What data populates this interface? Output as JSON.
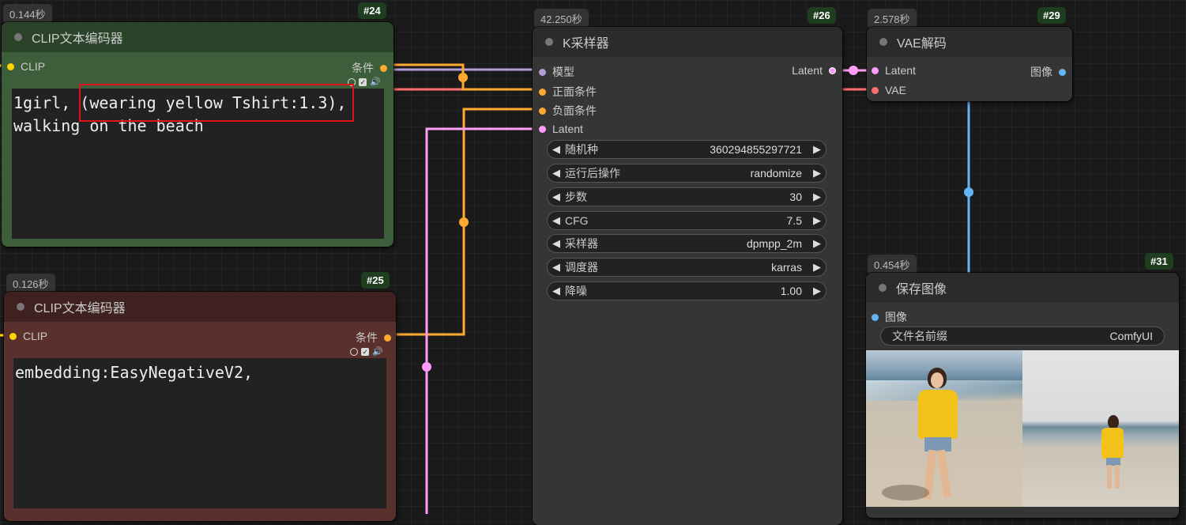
{
  "node24": {
    "time": "0.144秒",
    "id": "#24",
    "title": "CLIP文本编码器",
    "input_label": "CLIP",
    "output_label": "条件",
    "text": "1girl, (wearing yellow Tshirt:1.3),\nwalking on the beach",
    "color": "#2f4a2f"
  },
  "node25": {
    "time": "0.126秒",
    "id": "#25",
    "title": "CLIP文本编码器",
    "input_label": "CLIP",
    "output_label": "条件",
    "text": "embedding:EasyNegativeV2,",
    "color": "#4e2a2a"
  },
  "node26": {
    "time": "42.250秒",
    "id": "#26",
    "title": "K采样器",
    "inputs": [
      "模型",
      "正面条件",
      "负面条件",
      "Latent"
    ],
    "output_label": "Latent",
    "widgets": [
      {
        "label": "随机种",
        "value": "360294855297721"
      },
      {
        "label": "运行后操作",
        "value": "randomize"
      },
      {
        "label": "步数",
        "value": "30"
      },
      {
        "label": "CFG",
        "value": "7.5"
      },
      {
        "label": "采样器",
        "value": "dpmpp_2m"
      },
      {
        "label": "调度器",
        "value": "karras"
      },
      {
        "label": "降噪",
        "value": "1.00"
      }
    ]
  },
  "node29": {
    "time": "2.578秒",
    "id": "#29",
    "title": "VAE解码",
    "inputs": [
      "Latent",
      "VAE"
    ],
    "output_label": "图像"
  },
  "node31": {
    "time": "0.454秒",
    "id": "#31",
    "title": "保存图像",
    "input_label": "图像",
    "widget_label": "文件名前缀",
    "widget_value": "ComfyUI"
  },
  "colors": {
    "model": "#b39ddb",
    "conditioning": "#ffa931",
    "latent": "#ff9cf9",
    "vae": "#ff6e6e",
    "image": "#64b5f6",
    "clip": "#ffd500"
  }
}
